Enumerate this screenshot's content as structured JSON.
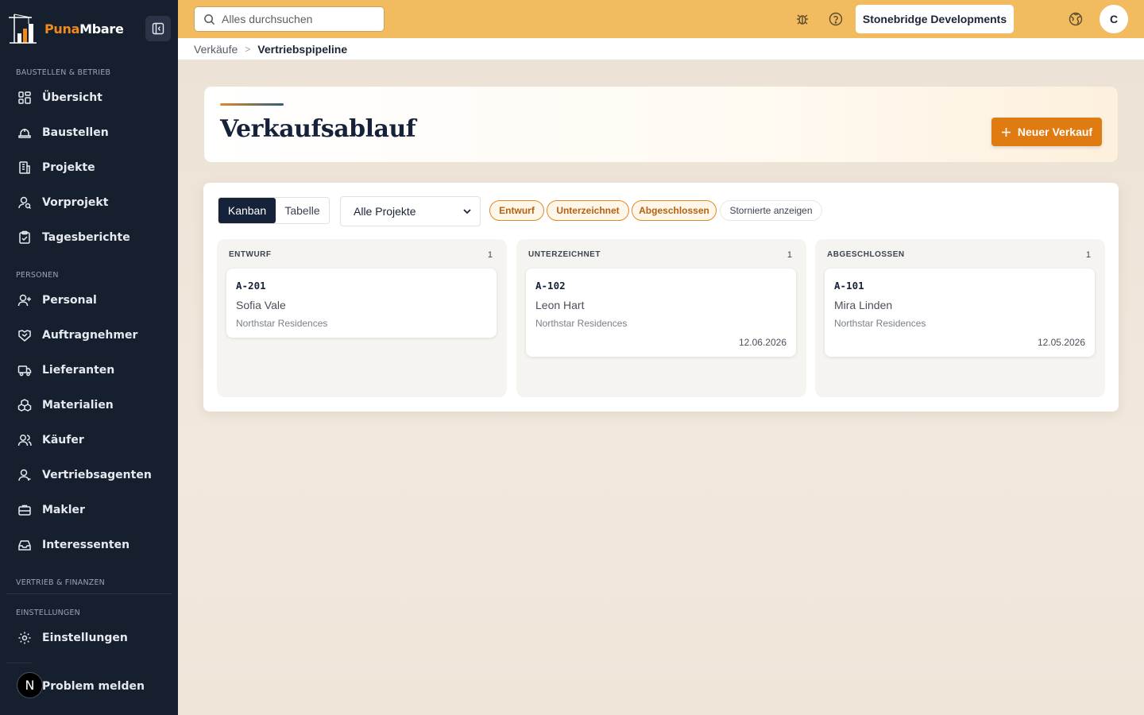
{
  "brand": {
    "name_part1": "Puna",
    "name_part2": "Mbare",
    "accent": "#f08a1c"
  },
  "sidebar": {
    "sections": {
      "ops": "BAUSTELLEN & BETRIEB",
      "people": "PERSONEN",
      "sales": "VERTRIEB & FINANZEN",
      "settings": "EINSTELLUNGEN"
    },
    "items": [
      {
        "label": "Übersicht",
        "icon": "dashboard-icon"
      },
      {
        "label": "Baustellen",
        "icon": "hardhat-icon"
      },
      {
        "label": "Projekte",
        "icon": "building-icon"
      },
      {
        "label": "Vorprojekt",
        "icon": "user-search-icon"
      },
      {
        "label": "Tagesberichte",
        "icon": "clipboard-icon"
      },
      {
        "label": "Personal",
        "icon": "user-plus-icon"
      },
      {
        "label": "Auftragnehmer",
        "icon": "handshake-icon"
      },
      {
        "label": "Lieferanten",
        "icon": "truck-icon"
      },
      {
        "label": "Materialien",
        "icon": "boxes-icon"
      },
      {
        "label": "Käufer",
        "icon": "users-icon"
      },
      {
        "label": "Vertriebsagenten",
        "icon": "user-icon"
      },
      {
        "label": "Makler",
        "icon": "briefcase-icon"
      },
      {
        "label": "Interessenten",
        "icon": "inbox-icon"
      },
      {
        "label": "Einstellungen",
        "icon": "gear-icon"
      },
      {
        "label": "Problem melden",
        "icon": "flag-icon"
      }
    ],
    "badge_letter": "N"
  },
  "topbar": {
    "search_placeholder": "Alles durchsuchen",
    "company": "Stonebridge Developments",
    "avatar_letter": "C"
  },
  "breadcrumb": {
    "parent": "Verkäufe",
    "separator": ">",
    "current": "Vertriebspipeline"
  },
  "header": {
    "title": "Verkaufsablauf",
    "new_button": "Neuer Verkauf"
  },
  "toolbar": {
    "view_kanban": "Kanban",
    "view_table": "Tabelle",
    "project_filter": "Alle Projekte",
    "chips": [
      "Entwurf",
      "Unterzeichnet",
      "Abgeschlossen"
    ],
    "show_cancelled": "Stornierte anzeigen"
  },
  "columns": [
    {
      "title": "ENTWURF",
      "count": "1",
      "card": {
        "code": "A-201",
        "buyer": "Sofia Vale",
        "project": "Northstar Residences",
        "date": ""
      }
    },
    {
      "title": "UNTERZEICHNET",
      "count": "1",
      "card": {
        "code": "A-102",
        "buyer": "Leon Hart",
        "project": "Northstar Residences",
        "date": "12.06.2026"
      }
    },
    {
      "title": "ABGESCHLOSSEN",
      "count": "1",
      "card": {
        "code": "A-101",
        "buyer": "Mira Linden",
        "project": "Northstar Residences",
        "date": "12.05.2026"
      }
    }
  ],
  "colors": {
    "sidebar": "#161f2e",
    "topbar": "#f2bb5f",
    "primary": "#e07b12",
    "navy": "#16213a"
  }
}
